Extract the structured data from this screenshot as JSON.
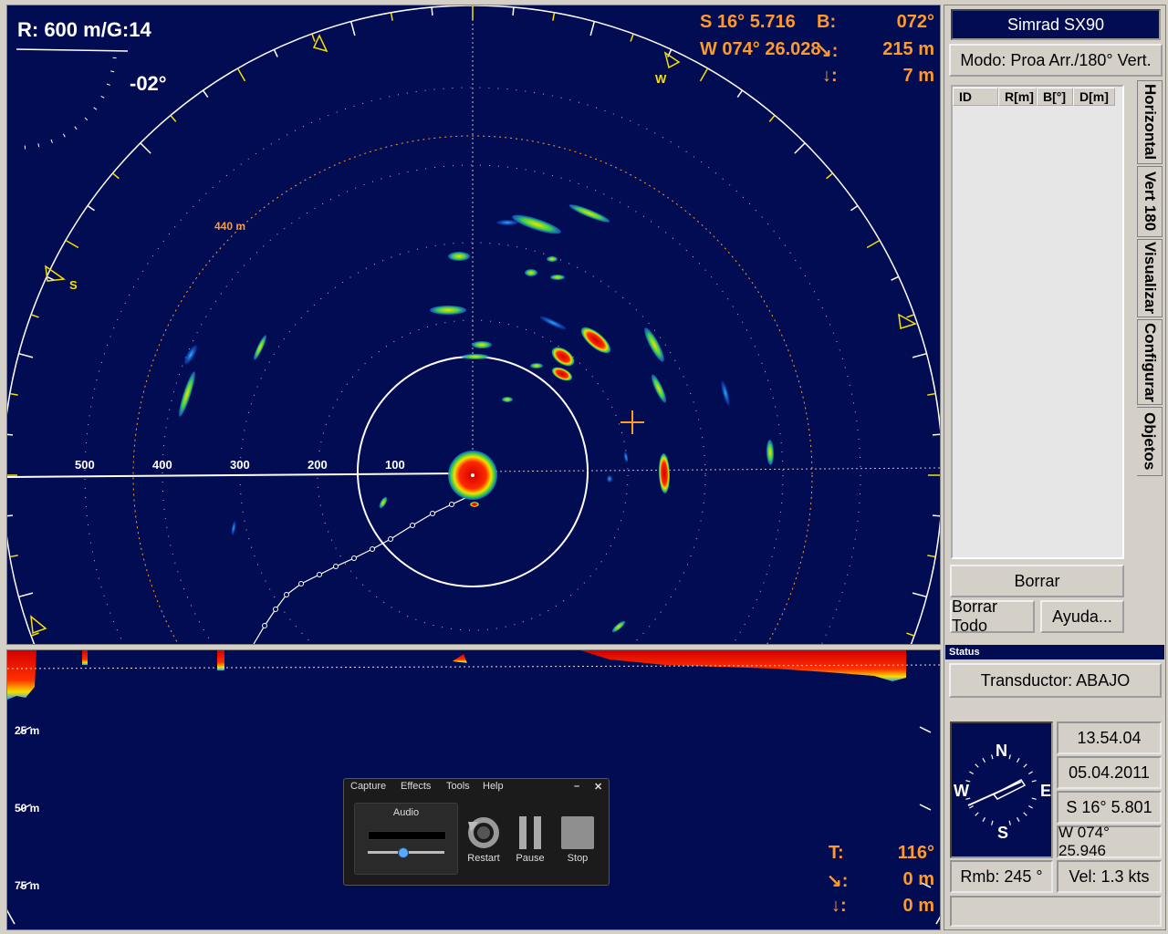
{
  "sonar": {
    "range_label": "R:  600 m/G:14",
    "tilt_label": "-02°",
    "pos_lat": "S  16° 5.716",
    "pos_lon": "W 074° 26.028",
    "bearing_label": "B:",
    "bearing_value": "072°",
    "slant_label": "↘:",
    "slant_value": "215 m",
    "depth_label": "↓:",
    "depth_value": "7 m",
    "ring_label": "440 m",
    "scale_labels": [
      "500",
      "400",
      "300",
      "200",
      "100"
    ],
    "compass_marks": [
      "S",
      "W"
    ],
    "colors": {
      "background": "#020c52",
      "echo_strong": "#e01000",
      "echo_mid": "#f0e000",
      "echo_weak": "#1aa0ff",
      "accent": "#ff9a2a"
    }
  },
  "vertical_view": {
    "depth_labels": [
      "25 m",
      "50 m",
      "75 m"
    ],
    "tilt_label": "T:",
    "tilt_value": "116°",
    "slant_label": "↘:",
    "slant_value": "0 m",
    "depth_label": "↓:",
    "depth_value": "0 m"
  },
  "capture_window": {
    "menu": [
      "Capture",
      "Effects",
      "Tools",
      "Help"
    ],
    "audio_label": "Audio",
    "audio_level": 0.45,
    "restart_label": "Restart",
    "pause_label": "Pause",
    "stop_label": "Stop",
    "minimize": "–",
    "close": "✕"
  },
  "right_panel": {
    "title": "Simrad SX90",
    "mode": "Modo: Proa Arr./180° Vert.",
    "table_headers": [
      "ID",
      "R[m]",
      "B[°]",
      "D[m]"
    ],
    "tabs": [
      "Horizontal",
      "Vert 180",
      "Visualizar",
      "Configurar",
      "Objetos"
    ],
    "btn_borrar": "Borrar",
    "btn_borrar_todo": "Borrar Todo",
    "btn_ayuda": "Ayuda...",
    "status_title": "Status",
    "transducer": "Transductor: ABAJO",
    "time": "13.54.04",
    "date": "05.04.2011",
    "lat": "S  16° 5.801",
    "lon": "W 074° 25.946",
    "heading": "Rmb: 245 °",
    "speed": "Vel: 1.3 kts",
    "compass": [
      "N",
      "E",
      "S",
      "W"
    ]
  }
}
